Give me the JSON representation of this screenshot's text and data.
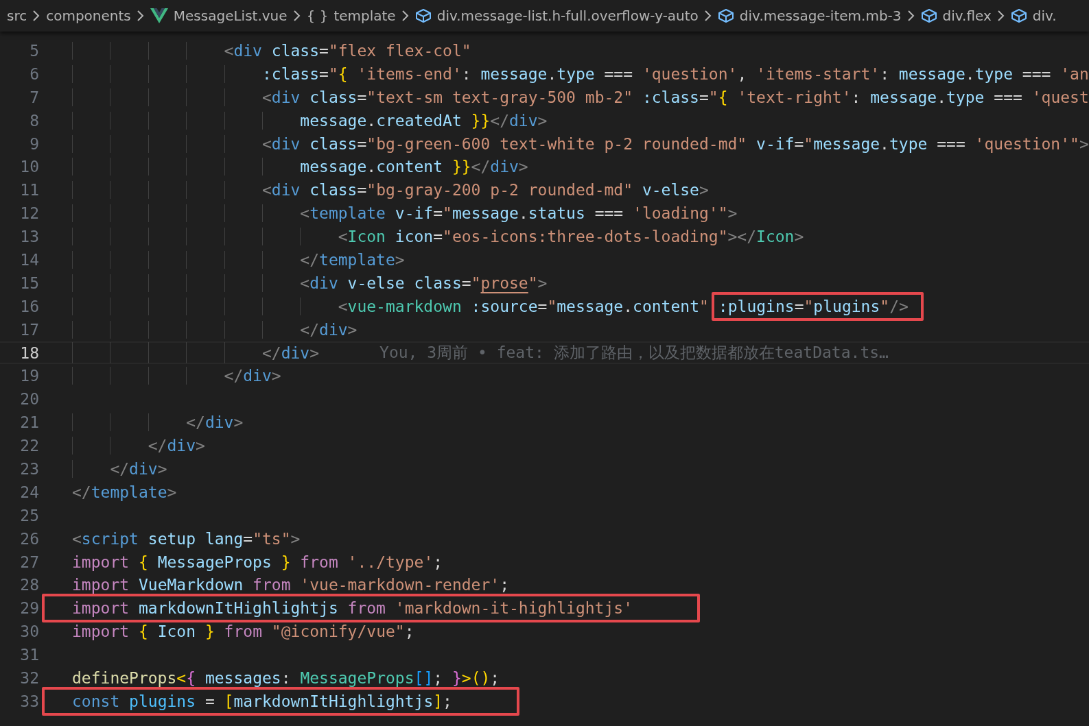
{
  "breadcrumbs": [
    {
      "kind": "folder",
      "label": "src"
    },
    {
      "kind": "folder",
      "label": "components"
    },
    {
      "kind": "vue-file",
      "label": "MessageList.vue"
    },
    {
      "kind": "namespace",
      "icon_text": "{ }",
      "label": "template"
    },
    {
      "kind": "element",
      "label": "div.message-list.h-full.overflow-y-auto"
    },
    {
      "kind": "element",
      "label": "div.message-item.mb-3"
    },
    {
      "kind": "element",
      "label": "div.flex"
    },
    {
      "kind": "element",
      "label": "div."
    }
  ],
  "lines": [
    {
      "number": "5",
      "tokens": [
        {
          "kind": "punct",
          "text": "                <"
        },
        {
          "kind": "tag",
          "text": "div"
        },
        {
          "kind": "attr",
          "text": " class"
        },
        {
          "kind": "plain",
          "text": "="
        },
        {
          "kind": "str",
          "text": "\"flex flex-col\""
        }
      ]
    },
    {
      "number": "6",
      "tokens": [
        {
          "kind": "attr",
          "text": "                    :class"
        },
        {
          "kind": "plain",
          "text": "="
        },
        {
          "kind": "str",
          "text": "\""
        },
        {
          "kind": "brace",
          "text": "{"
        },
        {
          "kind": "str",
          "text": " 'items-end'"
        },
        {
          "kind": "plain",
          "text": ": "
        },
        {
          "kind": "var",
          "text": "message"
        },
        {
          "kind": "plain",
          "text": "."
        },
        {
          "kind": "var",
          "text": "type"
        },
        {
          "kind": "plain",
          "text": " === "
        },
        {
          "kind": "str",
          "text": "'question'"
        },
        {
          "kind": "plain",
          "text": ", "
        },
        {
          "kind": "str",
          "text": "'items-start'"
        },
        {
          "kind": "plain",
          "text": ": "
        },
        {
          "kind": "var",
          "text": "message"
        },
        {
          "kind": "plain",
          "text": "."
        },
        {
          "kind": "var",
          "text": "type"
        },
        {
          "kind": "plain",
          "text": " === "
        },
        {
          "kind": "str",
          "text": "'an"
        }
      ]
    },
    {
      "number": "7",
      "tokens": [
        {
          "kind": "punct",
          "text": "                    <"
        },
        {
          "kind": "tag",
          "text": "div"
        },
        {
          "kind": "attr",
          "text": " class"
        },
        {
          "kind": "plain",
          "text": "="
        },
        {
          "kind": "str",
          "text": "\"text-sm text-gray-500 mb-2\""
        },
        {
          "kind": "attr",
          "text": " :class"
        },
        {
          "kind": "plain",
          "text": "="
        },
        {
          "kind": "str",
          "text": "\""
        },
        {
          "kind": "brace",
          "text": "{"
        },
        {
          "kind": "str",
          "text": " 'text-right'"
        },
        {
          "kind": "plain",
          "text": ": "
        },
        {
          "kind": "var",
          "text": "message"
        },
        {
          "kind": "plain",
          "text": "."
        },
        {
          "kind": "var",
          "text": "type"
        },
        {
          "kind": "plain",
          "text": " === "
        },
        {
          "kind": "str",
          "text": "'quest"
        }
      ]
    },
    {
      "number": "8",
      "tokens": [
        {
          "kind": "var",
          "text": "                        message"
        },
        {
          "kind": "plain",
          "text": "."
        },
        {
          "kind": "var",
          "text": "createdAt"
        },
        {
          "kind": "brace",
          "text": " }}"
        },
        {
          "kind": "punct",
          "text": "</"
        },
        {
          "kind": "tag",
          "text": "div"
        },
        {
          "kind": "punct",
          "text": ">"
        }
      ]
    },
    {
      "number": "9",
      "tokens": [
        {
          "kind": "punct",
          "text": "                    <"
        },
        {
          "kind": "tag",
          "text": "div"
        },
        {
          "kind": "attr",
          "text": " class"
        },
        {
          "kind": "plain",
          "text": "="
        },
        {
          "kind": "str",
          "text": "\"bg-green-600 text-white p-2 rounded-md\""
        },
        {
          "kind": "attr",
          "text": " v-if"
        },
        {
          "kind": "plain",
          "text": "="
        },
        {
          "kind": "str",
          "text": "\""
        },
        {
          "kind": "var",
          "text": "message"
        },
        {
          "kind": "plain",
          "text": "."
        },
        {
          "kind": "var",
          "text": "type"
        },
        {
          "kind": "plain",
          "text": " === "
        },
        {
          "kind": "str",
          "text": "'question'\""
        },
        {
          "kind": "punct",
          "text": ">"
        }
      ]
    },
    {
      "number": "10",
      "tokens": [
        {
          "kind": "var",
          "text": "                        message"
        },
        {
          "kind": "plain",
          "text": "."
        },
        {
          "kind": "var",
          "text": "content"
        },
        {
          "kind": "brace",
          "text": " }}"
        },
        {
          "kind": "punct",
          "text": "</"
        },
        {
          "kind": "tag",
          "text": "div"
        },
        {
          "kind": "punct",
          "text": ">"
        }
      ]
    },
    {
      "number": "11",
      "tokens": [
        {
          "kind": "punct",
          "text": "                    <"
        },
        {
          "kind": "tag",
          "text": "div"
        },
        {
          "kind": "attr",
          "text": " class"
        },
        {
          "kind": "plain",
          "text": "="
        },
        {
          "kind": "str",
          "text": "\"bg-gray-200 p-2 rounded-md\""
        },
        {
          "kind": "attr",
          "text": " v-else"
        },
        {
          "kind": "punct",
          "text": ">"
        }
      ]
    },
    {
      "number": "12",
      "tokens": [
        {
          "kind": "punct",
          "text": "                        <"
        },
        {
          "kind": "tag",
          "text": "template"
        },
        {
          "kind": "attr",
          "text": " v-if"
        },
        {
          "kind": "plain",
          "text": "="
        },
        {
          "kind": "str",
          "text": "\""
        },
        {
          "kind": "var",
          "text": "message"
        },
        {
          "kind": "plain",
          "text": "."
        },
        {
          "kind": "var",
          "text": "status"
        },
        {
          "kind": "plain",
          "text": " === "
        },
        {
          "kind": "str",
          "text": "'loading'\""
        },
        {
          "kind": "punct",
          "text": ">"
        }
      ]
    },
    {
      "number": "13",
      "tokens": [
        {
          "kind": "punct",
          "text": "                            <"
        },
        {
          "kind": "comp",
          "text": "Icon"
        },
        {
          "kind": "attr",
          "text": " icon"
        },
        {
          "kind": "plain",
          "text": "="
        },
        {
          "kind": "str",
          "text": "\"eos-icons:three-dots-loading\""
        },
        {
          "kind": "punct",
          "text": "></"
        },
        {
          "kind": "comp",
          "text": "Icon"
        },
        {
          "kind": "punct",
          "text": ">"
        }
      ]
    },
    {
      "number": "14",
      "tokens": [
        {
          "kind": "punct",
          "text": "                        </"
        },
        {
          "kind": "tag",
          "text": "template"
        },
        {
          "kind": "punct",
          "text": ">"
        }
      ]
    },
    {
      "number": "15",
      "tokens": [
        {
          "kind": "punct",
          "text": "                        <"
        },
        {
          "kind": "tag",
          "text": "div"
        },
        {
          "kind": "attr",
          "text": " v-else"
        },
        {
          "kind": "attr",
          "text": " class"
        },
        {
          "kind": "plain",
          "text": "="
        },
        {
          "kind": "str",
          "text": "\""
        },
        {
          "kind": "str-underlined",
          "text": "prose"
        },
        {
          "kind": "str",
          "text": "\""
        },
        {
          "kind": "punct",
          "text": ">"
        }
      ]
    },
    {
      "number": "16",
      "tokens": [
        {
          "kind": "punct",
          "text": "                            <"
        },
        {
          "kind": "comp",
          "text": "vue-markdown"
        },
        {
          "kind": "attr",
          "text": " :source"
        },
        {
          "kind": "plain",
          "text": "="
        },
        {
          "kind": "str",
          "text": "\""
        },
        {
          "kind": "var",
          "text": "message"
        },
        {
          "kind": "plain",
          "text": "."
        },
        {
          "kind": "var",
          "text": "content"
        },
        {
          "kind": "str",
          "text": "\""
        },
        {
          "kind": "attr",
          "text": ":plugins",
          "boxed": true
        },
        {
          "kind": "plain",
          "text": "=",
          "boxed": true
        },
        {
          "kind": "str",
          "text": "\"",
          "boxed": true
        },
        {
          "kind": "var",
          "text": "plugins",
          "boxed": true
        },
        {
          "kind": "str",
          "text": "\"",
          "boxed": true
        },
        {
          "kind": "punct",
          "text": "/>",
          "boxed": true
        }
      ]
    },
    {
      "number": "17",
      "tokens": [
        {
          "kind": "punct",
          "text": "                        </"
        },
        {
          "kind": "tag",
          "text": "div"
        },
        {
          "kind": "punct",
          "text": ">"
        }
      ]
    },
    {
      "number": "18",
      "current": true,
      "blame": "You, 3周前 • feat: 添加了路由，以及把数据都放在teatData.ts…",
      "tokens": [
        {
          "kind": "punct",
          "text": "                    </"
        },
        {
          "kind": "tag",
          "text": "div"
        },
        {
          "kind": "punct",
          "text": ">"
        }
      ]
    },
    {
      "number": "19",
      "tokens": [
        {
          "kind": "punct",
          "text": "                </"
        },
        {
          "kind": "tag",
          "text": "div"
        },
        {
          "kind": "punct",
          "text": ">"
        }
      ]
    },
    {
      "number": "20"
    },
    {
      "number": "21",
      "tokens": [
        {
          "kind": "punct",
          "text": "            </"
        },
        {
          "kind": "tag",
          "text": "div"
        },
        {
          "kind": "punct",
          "text": ">"
        }
      ]
    },
    {
      "number": "22",
      "tokens": [
        {
          "kind": "punct",
          "text": "        </"
        },
        {
          "kind": "tag",
          "text": "div"
        },
        {
          "kind": "punct",
          "text": ">"
        }
      ]
    },
    {
      "number": "23",
      "tokens": [
        {
          "kind": "punct",
          "text": "    </"
        },
        {
          "kind": "tag",
          "text": "div"
        },
        {
          "kind": "punct",
          "text": ">"
        }
      ]
    },
    {
      "number": "24",
      "tokens": [
        {
          "kind": "punct",
          "text": "</"
        },
        {
          "kind": "tag",
          "text": "template"
        },
        {
          "kind": "punct",
          "text": ">"
        }
      ]
    },
    {
      "number": "25"
    },
    {
      "number": "26",
      "tokens": [
        {
          "kind": "punct",
          "text": "<"
        },
        {
          "kind": "tag",
          "text": "script"
        },
        {
          "kind": "attr",
          "text": " setup"
        },
        {
          "kind": "attr",
          "text": " lang"
        },
        {
          "kind": "plain",
          "text": "="
        },
        {
          "kind": "str",
          "text": "\"ts\""
        },
        {
          "kind": "punct",
          "text": ">"
        }
      ]
    },
    {
      "number": "27",
      "tokens": [
        {
          "kind": "kw",
          "text": "import"
        },
        {
          "kind": "brace",
          "text": " {"
        },
        {
          "kind": "var",
          "text": " MessageProps"
        },
        {
          "kind": "brace",
          "text": " }"
        },
        {
          "kind": "kw",
          "text": " from"
        },
        {
          "kind": "str",
          "text": " '../type'"
        },
        {
          "kind": "plain",
          "text": ";"
        }
      ]
    },
    {
      "number": "28",
      "tokens": [
        {
          "kind": "kw",
          "text": "import"
        },
        {
          "kind": "var",
          "text": " VueMarkdown"
        },
        {
          "kind": "kw",
          "text": " from"
        },
        {
          "kind": "str",
          "text": " 'vue-markdown-render'"
        },
        {
          "kind": "plain",
          "text": ";"
        }
      ]
    },
    {
      "number": "29",
      "boxed": true,
      "tokens": [
        {
          "kind": "kw",
          "text": "import"
        },
        {
          "kind": "var",
          "text": " markdownItHighlightjs"
        },
        {
          "kind": "kw",
          "text": " from"
        },
        {
          "kind": "str",
          "text": " 'markdown-it-highlightjs'"
        }
      ]
    },
    {
      "number": "30",
      "tokens": [
        {
          "kind": "kw",
          "text": "import"
        },
        {
          "kind": "brace",
          "text": " {"
        },
        {
          "kind": "var",
          "text": " Icon"
        },
        {
          "kind": "brace",
          "text": " }"
        },
        {
          "kind": "kw",
          "text": " from"
        },
        {
          "kind": "str",
          "text": " \"@iconify/vue\""
        },
        {
          "kind": "plain",
          "text": ";"
        }
      ]
    },
    {
      "number": "31"
    },
    {
      "number": "32",
      "tokens": [
        {
          "kind": "fn",
          "text": "defineProps"
        },
        {
          "kind": "brace",
          "text": "<"
        },
        {
          "kind": "brace2",
          "text": "{"
        },
        {
          "kind": "var",
          "text": " messages"
        },
        {
          "kind": "plain",
          "text": ": "
        },
        {
          "kind": "type",
          "text": "MessageProps"
        },
        {
          "kind": "brace3",
          "text": "[]"
        },
        {
          "kind": "plain",
          "text": "; "
        },
        {
          "kind": "brace2",
          "text": "}"
        },
        {
          "kind": "brace",
          "text": ">()"
        },
        {
          "kind": "plain",
          "text": ";"
        }
      ]
    },
    {
      "number": "33",
      "boxed": true,
      "tokens": [
        {
          "kind": "store",
          "text": "const"
        },
        {
          "kind": "const",
          "text": " plugins"
        },
        {
          "kind": "plain",
          "text": " = "
        },
        {
          "kind": "brace",
          "text": "["
        },
        {
          "kind": "var",
          "text": "markdownItHighlightjs"
        },
        {
          "kind": "brace",
          "text": "]"
        },
        {
          "kind": "plain",
          "text": ";"
        }
      ]
    }
  ]
}
